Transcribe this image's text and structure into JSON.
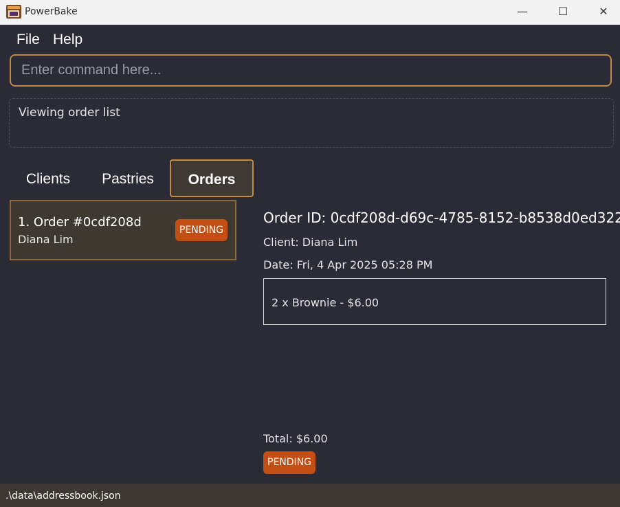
{
  "window": {
    "title": "PowerBake",
    "app_icon": "oven-icon",
    "minimize_glyph": "—",
    "maximize_glyph": "☐",
    "close_glyph": "✕"
  },
  "menu": {
    "file": "File",
    "help": "Help"
  },
  "command": {
    "placeholder": "Enter command here...",
    "value": ""
  },
  "result": {
    "text": "Viewing order list"
  },
  "tabs": [
    {
      "label": "Clients",
      "active": false
    },
    {
      "label": "Pastries",
      "active": false
    },
    {
      "label": "Orders",
      "active": true
    }
  ],
  "orders": [
    {
      "title": "1. Order #0cdf208d",
      "client": "Diana Lim",
      "status": "PENDING"
    }
  ],
  "detail": {
    "order_id": "Order ID: 0cdf208d-d69c-4785-8152-b8538d0ed322",
    "client": "Client: Diana Lim",
    "date": "Date: Fri, 4 Apr 2025 05:28 PM",
    "items": [
      "2 x Brownie - $6.00"
    ],
    "total": "Total: $6.00",
    "status": "PENDING"
  },
  "status_bar": {
    "path": ".\\data\\addressbook.json"
  },
  "colors": {
    "background": "#2a2b37",
    "accent": "#c08b45",
    "pending_badge": "#c44f14",
    "status_bar": "#3e3833"
  }
}
